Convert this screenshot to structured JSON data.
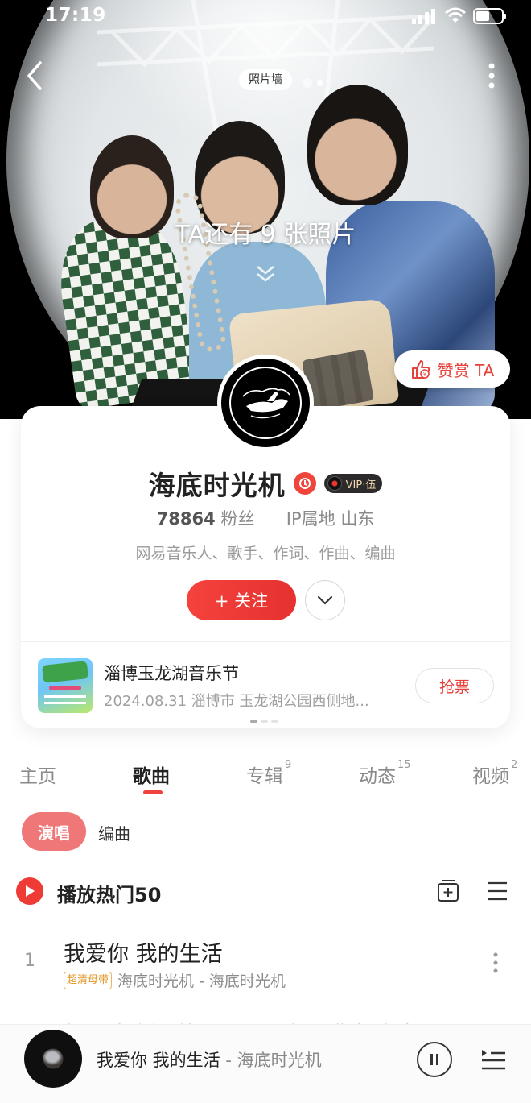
{
  "status_bar": {
    "time": "17:19"
  },
  "hero": {
    "photo_wall_label": "照片墙",
    "more_photos_text": "TA还有 9 张照片",
    "tip_button": "赞赏 TA"
  },
  "profile": {
    "name": "海底时光机",
    "vip_label": "VIP·伍",
    "fans_count": "78864",
    "fans_label": "粉丝",
    "ip_location": "IP属地 山东",
    "roles": "网易音乐人、歌手、作词、作曲、编曲",
    "follow_button": "+ 关注"
  },
  "event": {
    "title": "淄博玉龙湖音乐节",
    "subtitle": "2024.08.31 淄博市 玉龙湖公园西侧地...",
    "ticket_button": "抢票"
  },
  "tabs": [
    {
      "label": "主页",
      "badge": ""
    },
    {
      "label": "歌曲",
      "badge": ""
    },
    {
      "label": "专辑",
      "badge": "9"
    },
    {
      "label": "动态",
      "badge": "15"
    },
    {
      "label": "视频",
      "badge": "2"
    }
  ],
  "filters": {
    "sing": "演唱",
    "arrange": "编曲"
  },
  "playlist": {
    "play_all_label": "播放热门50"
  },
  "songs": [
    {
      "index": "1",
      "title": "我爱你 我的生活",
      "quality": "超清母带",
      "artist_album": "海底时光机 - 海底时光机"
    }
  ],
  "next_song_partial": "打工这个没送 SUPER (如果你想出去",
  "mini_player": {
    "title": "我爱你 我的生活",
    "separator": "-",
    "artist": "海底时光机"
  },
  "colors": {
    "accent": "#e8403a",
    "chip": "#f07777",
    "vip_gold": "#f3d9b1"
  }
}
